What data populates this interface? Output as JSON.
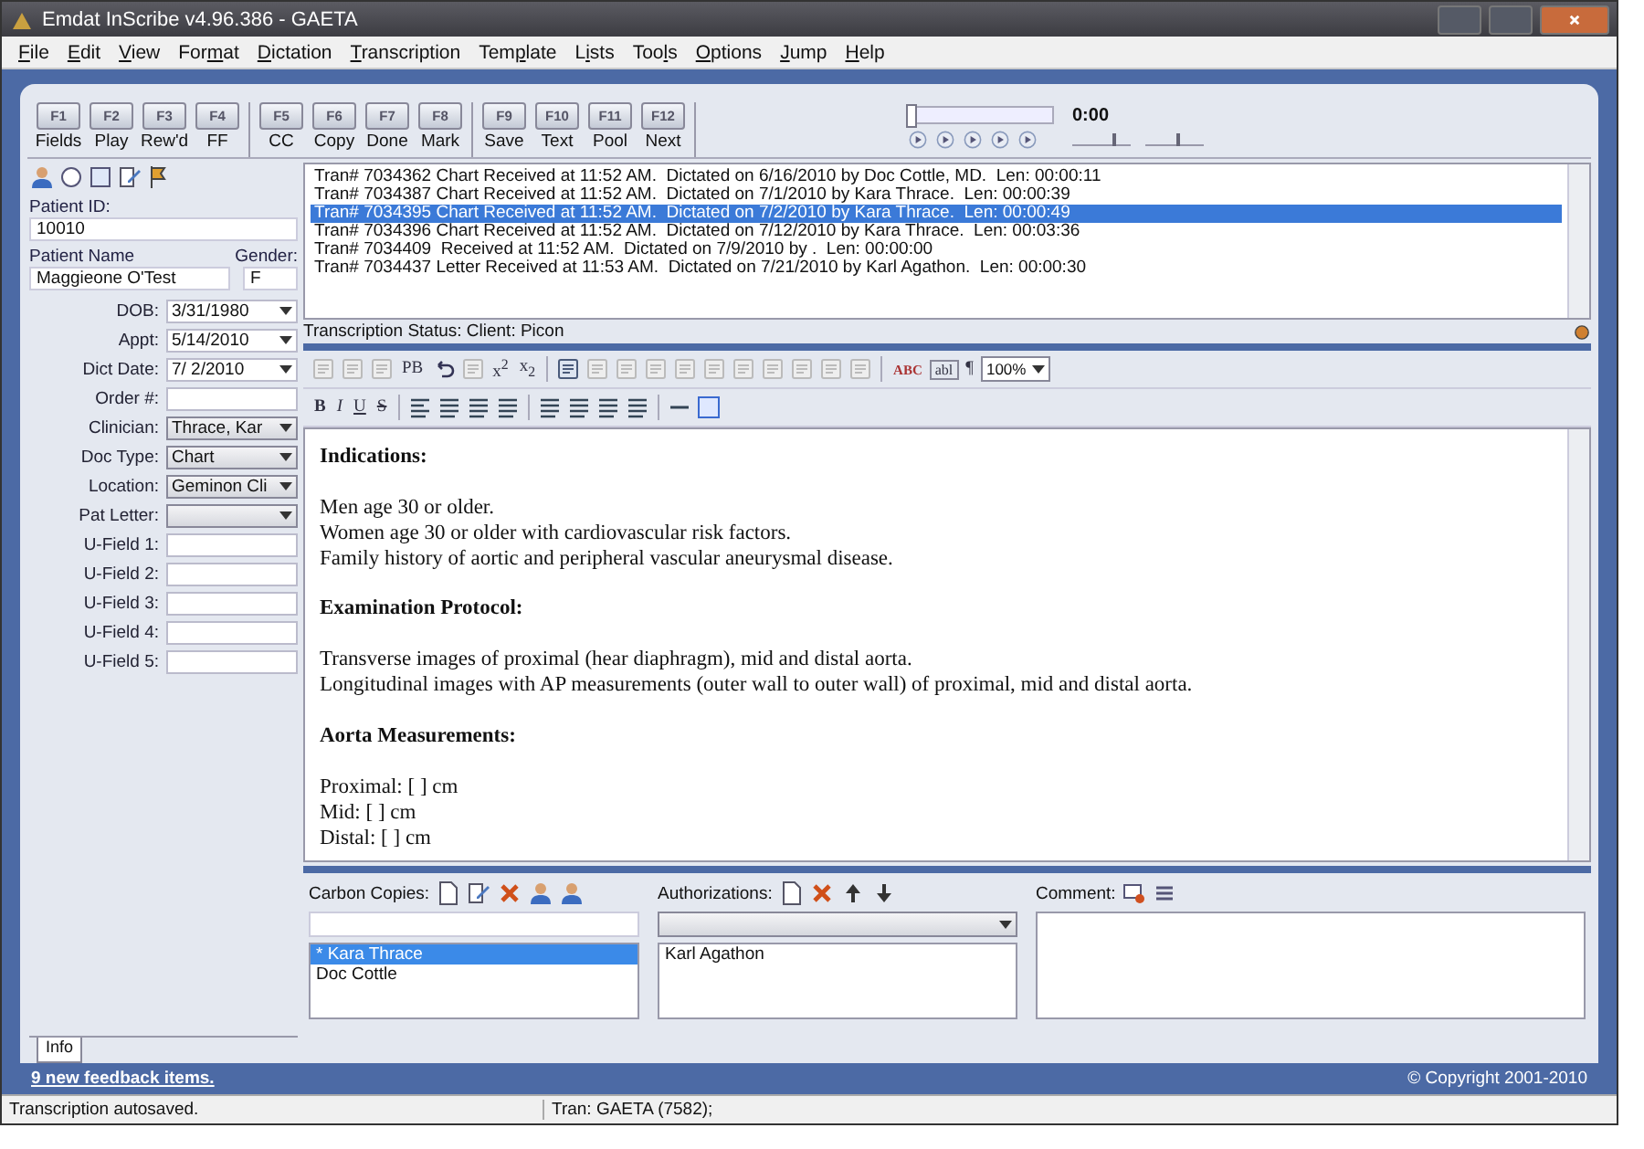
{
  "window": {
    "title": "Emdat InScribe v4.96.386 - GAETA"
  },
  "menu": [
    {
      "key": "F",
      "after": "ile"
    },
    {
      "key": "E",
      "after": "dit"
    },
    {
      "key": "V",
      "after": "iew"
    },
    {
      "before": "For",
      "key": "m",
      "after": "at"
    },
    {
      "key": "D",
      "after": "ictation"
    },
    {
      "key": "T",
      "after": "ranscription"
    },
    {
      "before": "Tem",
      "key": "p",
      "after": "late"
    },
    {
      "before": "L",
      "key": "i",
      "after": "sts"
    },
    {
      "before": "Too",
      "key": "l",
      "after": "s"
    },
    {
      "key": "O",
      "after": "ptions"
    },
    {
      "key": "J",
      "after": "ump"
    },
    {
      "key": "H",
      "after": "elp"
    }
  ],
  "fkey_groups": [
    [
      {
        "key": "F1",
        "label": "Fields"
      },
      {
        "key": "F2",
        "label": "Play"
      },
      {
        "key": "F3",
        "label": "Rew'd"
      },
      {
        "key": "F4",
        "label": "FF"
      }
    ],
    [
      {
        "key": "F5",
        "label": "CC"
      },
      {
        "key": "F6",
        "label": "Copy"
      },
      {
        "key": "F7",
        "label": "Done"
      },
      {
        "key": "F8",
        "label": "Mark"
      }
    ],
    [
      {
        "key": "F9",
        "label": "Save"
      },
      {
        "key": "F10",
        "label": "Text"
      },
      {
        "key": "F11",
        "label": "Pool"
      },
      {
        "key": "F12",
        "label": "Next"
      }
    ]
  ],
  "player": {
    "position": {
      "level": 0
    },
    "time": "0:00",
    "volume": {
      "level": 0.75
    },
    "speed": {
      "level": 0.6
    }
  },
  "patient": {
    "id_label": "Patient ID:",
    "id": "10010",
    "name_label": "Patient Name",
    "name": "Maggieone O'Test",
    "gender_label": "Gender:",
    "gender": "F"
  },
  "fields": [
    {
      "label": "DOB:",
      "value": "3/31/1980",
      "kind": "date"
    },
    {
      "label": "Appt:",
      "value": "5/14/2010",
      "kind": "date"
    },
    {
      "label": "Dict Date:",
      "value": "7/ 2/2010",
      "kind": "date"
    },
    {
      "label": "Order #:",
      "kind": "text"
    },
    {
      "label": "Clinician:",
      "value": "Thrace, Kar",
      "kind": "combo"
    },
    {
      "label": "Doc Type:",
      "value": "Chart",
      "kind": "combo"
    },
    {
      "label": "Location:",
      "value": "Geminon Cli",
      "kind": "combo"
    },
    {
      "label": "Pat Letter:",
      "kind": "combo"
    },
    {
      "label": "U-Field 1:",
      "kind": "text"
    },
    {
      "label": "U-Field 2:",
      "kind": "text"
    },
    {
      "label": "U-Field 3:",
      "kind": "text"
    },
    {
      "label": "U-Field 4:",
      "kind": "text"
    },
    {
      "label": "U-Field 5:",
      "kind": "text"
    }
  ],
  "left_tabs": [
    {
      "label": "Info",
      "selected": true
    }
  ],
  "transcriptions": [
    {
      "text": "Tran# 7034362 Chart Received at 11:52 AM.  Dictated on 6/16/2010 by Doc Cottle, MD.  Len: 00:00:11",
      "selected": false
    },
    {
      "text": "Tran# 7034387 Chart Received at 11:52 AM.  Dictated on 7/1/2010 by Kara Thrace.  Len: 00:00:39",
      "selected": false
    },
    {
      "text": "Tran# 7034395 Chart Received at 11:52 AM.  Dictated on 7/2/2010 by Kara Thrace.  Len: 00:00:49",
      "selected": true
    },
    {
      "text": "Tran# 7034396 Chart Received at 11:52 AM.  Dictated on 7/12/2010 by Kara Thrace.  Len: 00:03:36",
      "selected": false
    },
    {
      "text": "Tran# 7034409  Received at 11:52 AM.  Dictated on 7/9/2010 by .  Len: 00:00:00",
      "selected": false
    },
    {
      "text": "Tran# 7034437 Letter Received at 11:53 AM.  Dictated on 7/21/2010 by Karl Agathon.  Len: 00:00:30",
      "selected": false
    }
  ],
  "transcription_status": "Transcription Status: Client: Picon",
  "editor_toolbar": {
    "row_1_texts": [
      "PB",
      "x$^{2}$",
      "x$_{2}$",
      "ABC",
      "abl",
      "¶"
    ],
    "zoom": "100%",
    "row_2_texts": [
      "B",
      "I",
      "U",
      "S"
    ]
  },
  "document": [
    {
      "kind": "heading",
      "text": "Indications:"
    },
    {
      "kind": "blank"
    },
    {
      "kind": "line",
      "text": "Men age 30 or older."
    },
    {
      "kind": "line",
      "text": "Women age 30 or older with cardiovascular risk factors."
    },
    {
      "kind": "line",
      "text": "Family history of aortic and peripheral vascular aneurysmal disease."
    },
    {
      "kind": "blank"
    },
    {
      "kind": "heading",
      "text": "Examination Protocol:"
    },
    {
      "kind": "blank"
    },
    {
      "kind": "line",
      "text": "Transverse images of proximal (hear diaphragm), mid and distal aorta."
    },
    {
      "kind": "line",
      "text": "Longitudinal images with AP measurements (outer wall to outer wall) of proximal, mid and distal aorta."
    },
    {
      "kind": "blank"
    },
    {
      "kind": "heading",
      "text": "Aorta Measurements:"
    },
    {
      "kind": "blank"
    },
    {
      "kind": "line",
      "text": "Proximal: [ ] cm"
    },
    {
      "kind": "line",
      "text": "Mid: [ ] cm"
    },
    {
      "kind": "line",
      "text": "Distal: [ ] cm"
    }
  ],
  "carbon_copies": {
    "label": "Carbon Copies:",
    "items": [
      {
        "text": "* Kara Thrace",
        "selected": true
      },
      {
        "text": "Doc Cottle",
        "selected": false
      }
    ]
  },
  "authorizations": {
    "label": "Authorizations:",
    "items": [
      {
        "text": "Karl Agathon",
        "selected": false
      }
    ]
  },
  "comment": {
    "label": "Comment:"
  },
  "footer": {
    "feedback_link": "9 new feedback items.",
    "copyright": "© Copyright 2001-2010"
  },
  "status_bar": [
    "Transcription autosaved.",
    "Tran: GAETA (7582);"
  ]
}
